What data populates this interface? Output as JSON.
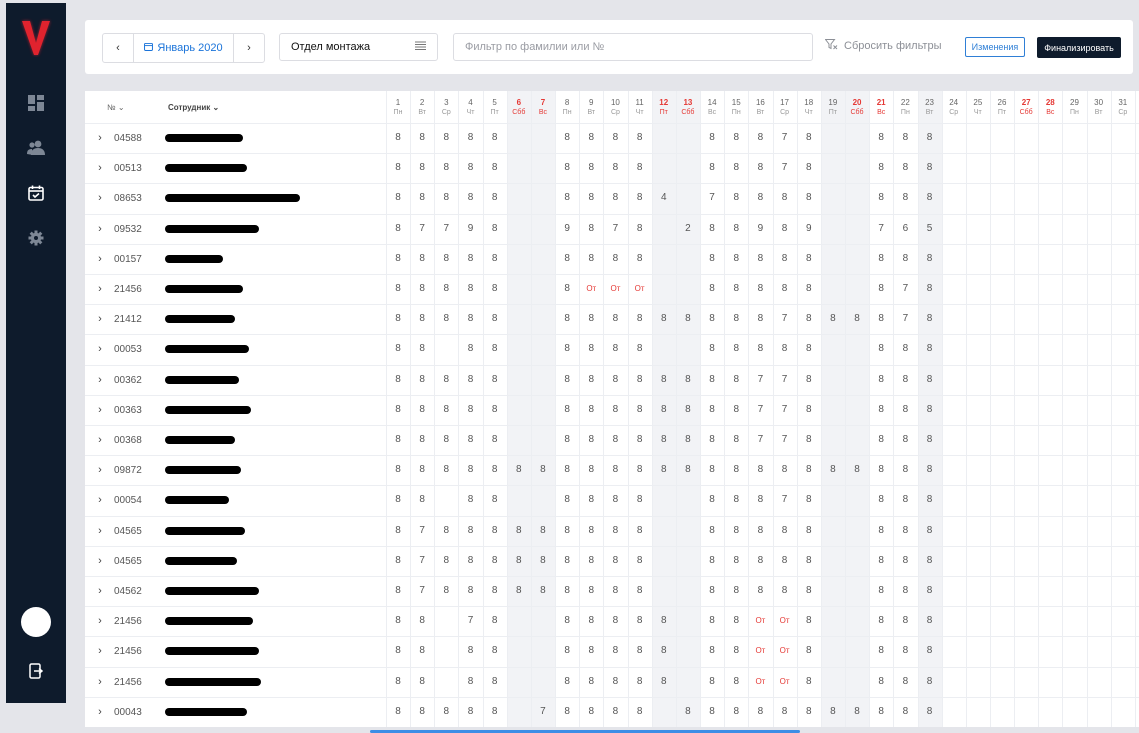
{
  "app": {
    "logo_letter": "V"
  },
  "sidebar": {
    "icons": [
      "dashboard-icon",
      "users-icon",
      "calendar-check-icon",
      "gear-icon"
    ],
    "logout_icon": "logout-icon"
  },
  "toolbar": {
    "month_label": "Январь 2020",
    "department": "Отдел монтажа",
    "filter_placeholder": "Фильтр по фамилии или №",
    "reset_label": "Сбросить фильтры",
    "changes_label": "Изменения",
    "finalize_label": "Финализировать"
  },
  "table": {
    "col_no": "№",
    "col_employee": "Сотрудник",
    "days": [
      {
        "d": "1",
        "w": "Пн",
        "h": false
      },
      {
        "d": "2",
        "w": "Вт",
        "h": false
      },
      {
        "d": "3",
        "w": "Ср",
        "h": false
      },
      {
        "d": "4",
        "w": "Чт",
        "h": false
      },
      {
        "d": "5",
        "w": "Пт",
        "h": false
      },
      {
        "d": "6",
        "w": "Сбб",
        "h": true
      },
      {
        "d": "7",
        "w": "Вс",
        "h": true
      },
      {
        "d": "8",
        "w": "Пн",
        "h": false
      },
      {
        "d": "9",
        "w": "Вт",
        "h": false
      },
      {
        "d": "10",
        "w": "Ср",
        "h": false
      },
      {
        "d": "11",
        "w": "Чт",
        "h": false
      },
      {
        "d": "12",
        "w": "Пт",
        "h": true
      },
      {
        "d": "13",
        "w": "Сбб",
        "h": true
      },
      {
        "d": "14",
        "w": "Вс",
        "h": false
      },
      {
        "d": "15",
        "w": "Пн",
        "h": false
      },
      {
        "d": "16",
        "w": "Вт",
        "h": false
      },
      {
        "d": "17",
        "w": "Ср",
        "h": false
      },
      {
        "d": "18",
        "w": "Чт",
        "h": false
      },
      {
        "d": "19",
        "w": "Пт",
        "h": false
      },
      {
        "d": "20",
        "w": "Сбб",
        "h": true
      },
      {
        "d": "21",
        "w": "Вс",
        "h": true
      },
      {
        "d": "22",
        "w": "Пн",
        "h": false
      },
      {
        "d": "23",
        "w": "Вт",
        "h": false
      },
      {
        "d": "24",
        "w": "Ср",
        "h": false
      },
      {
        "d": "25",
        "w": "Чт",
        "h": false
      },
      {
        "d": "26",
        "w": "Пт",
        "h": false
      },
      {
        "d": "27",
        "w": "Сбб",
        "h": true
      },
      {
        "d": "28",
        "w": "Вс",
        "h": true
      },
      {
        "d": "29",
        "w": "Пн",
        "h": false
      },
      {
        "d": "30",
        "w": "Вт",
        "h": false
      },
      {
        "d": "31",
        "w": "Ср",
        "h": false
      }
    ],
    "shaded_days": [
      6,
      7,
      12,
      13,
      19,
      20,
      23
    ],
    "rows": [
      {
        "id": "04588",
        "cells": [
          "8",
          "8",
          "8",
          "8",
          "8",
          "",
          "",
          "8",
          "8",
          "8",
          "8",
          "",
          "",
          "8",
          "8",
          "8",
          "7",
          "8",
          "",
          "",
          "8",
          "8",
          "8",
          "",
          "",
          "",
          "",
          "",
          "",
          "",
          ""
        ]
      },
      {
        "id": "00513",
        "cells": [
          "8",
          "8",
          "8",
          "8",
          "8",
          "",
          "",
          "8",
          "8",
          "8",
          "8",
          "",
          "",
          "8",
          "8",
          "8",
          "7",
          "8",
          "",
          "",
          "8",
          "8",
          "8",
          "",
          "",
          "",
          "",
          "",
          "",
          "",
          ""
        ]
      },
      {
        "id": "08653",
        "cells": [
          "8",
          "8",
          "8",
          "8",
          "8",
          "",
          "",
          "8",
          "8",
          "8",
          "8",
          "4",
          "",
          "7",
          "8",
          "8",
          "8",
          "8",
          "",
          "",
          "8",
          "8",
          "8",
          "",
          "",
          "",
          "",
          "",
          "",
          "",
          ""
        ]
      },
      {
        "id": "09532",
        "cells": [
          "8",
          "7",
          "7",
          "9",
          "8",
          "",
          "",
          "9",
          "8",
          "7",
          "8",
          "",
          "2",
          "8",
          "8",
          "9",
          "8",
          "9",
          "",
          "",
          "7",
          "6",
          "5",
          "",
          "",
          "",
          "",
          "",
          "",
          "",
          ""
        ]
      },
      {
        "id": "00157",
        "cells": [
          "8",
          "8",
          "8",
          "8",
          "8",
          "",
          "",
          "8",
          "8",
          "8",
          "8",
          "",
          "",
          "8",
          "8",
          "8",
          "8",
          "8",
          "",
          "",
          "8",
          "8",
          "8",
          "",
          "",
          "",
          "",
          "",
          "",
          "",
          ""
        ]
      },
      {
        "id": "21456",
        "cells": [
          "8",
          "8",
          "8",
          "8",
          "8",
          "",
          "",
          "8",
          "От",
          "От",
          "От",
          "",
          "",
          "8",
          "8",
          "8",
          "8",
          "8",
          "",
          "",
          "8",
          "7",
          "8",
          "",
          "",
          "",
          "",
          "",
          "",
          "",
          ""
        ]
      },
      {
        "id": "21412",
        "cells": [
          "8",
          "8",
          "8",
          "8",
          "8",
          "",
          "",
          "8",
          "8",
          "8",
          "8",
          "8",
          "8",
          "8",
          "8",
          "8",
          "7",
          "8",
          "8",
          "8",
          "8",
          "7",
          "8",
          "",
          "",
          "",
          "",
          "",
          "",
          "",
          ""
        ]
      },
      {
        "id": "00053",
        "cells": [
          "8",
          "8",
          "",
          "8",
          "8",
          "",
          "",
          "8",
          "8",
          "8",
          "8",
          "",
          "",
          "8",
          "8",
          "8",
          "8",
          "8",
          "",
          "",
          "8",
          "8",
          "8",
          "",
          "",
          "",
          "",
          "",
          "",
          "",
          ""
        ]
      },
      {
        "id": "00362",
        "cells": [
          "8",
          "8",
          "8",
          "8",
          "8",
          "",
          "",
          "8",
          "8",
          "8",
          "8",
          "8",
          "8",
          "8",
          "8",
          "7",
          "7",
          "8",
          "",
          "",
          "8",
          "8",
          "8",
          "",
          "",
          "",
          "",
          "",
          "",
          "",
          ""
        ]
      },
      {
        "id": "00363",
        "cells": [
          "8",
          "8",
          "8",
          "8",
          "8",
          "",
          "",
          "8",
          "8",
          "8",
          "8",
          "8",
          "8",
          "8",
          "8",
          "7",
          "7",
          "8",
          "",
          "",
          "8",
          "8",
          "8",
          "",
          "",
          "",
          "",
          "",
          "",
          "",
          ""
        ]
      },
      {
        "id": "00368",
        "cells": [
          "8",
          "8",
          "8",
          "8",
          "8",
          "",
          "",
          "8",
          "8",
          "8",
          "8",
          "8",
          "8",
          "8",
          "8",
          "7",
          "7",
          "8",
          "",
          "",
          "8",
          "8",
          "8",
          "",
          "",
          "",
          "",
          "",
          "",
          "",
          ""
        ]
      },
      {
        "id": "09872",
        "cells": [
          "8",
          "8",
          "8",
          "8",
          "8",
          "8",
          "8",
          "8",
          "8",
          "8",
          "8",
          "8",
          "8",
          "8",
          "8",
          "8",
          "8",
          "8",
          "8",
          "8",
          "8",
          "8",
          "8",
          "",
          "",
          "",
          "",
          "",
          "",
          "",
          ""
        ]
      },
      {
        "id": "00054",
        "cells": [
          "8",
          "8",
          "",
          "8",
          "8",
          "",
          "",
          "8",
          "8",
          "8",
          "8",
          "",
          "",
          "8",
          "8",
          "8",
          "7",
          "8",
          "",
          "",
          "8",
          "8",
          "8",
          "",
          "",
          "",
          "",
          "",
          "",
          "",
          ""
        ]
      },
      {
        "id": "04565",
        "cells": [
          "8",
          "7",
          "8",
          "8",
          "8",
          "8",
          "8",
          "8",
          "8",
          "8",
          "8",
          "",
          "",
          "8",
          "8",
          "8",
          "8",
          "8",
          "",
          "",
          "8",
          "8",
          "8",
          "",
          "",
          "",
          "",
          "",
          "",
          "",
          ""
        ]
      },
      {
        "id": "04565",
        "cells": [
          "8",
          "7",
          "8",
          "8",
          "8",
          "8",
          "8",
          "8",
          "8",
          "8",
          "8",
          "",
          "",
          "8",
          "8",
          "8",
          "8",
          "8",
          "",
          "",
          "8",
          "8",
          "8",
          "",
          "",
          "",
          "",
          "",
          "",
          "",
          ""
        ]
      },
      {
        "id": "04562",
        "cells": [
          "8",
          "7",
          "8",
          "8",
          "8",
          "8",
          "8",
          "8",
          "8",
          "8",
          "8",
          "",
          "",
          "8",
          "8",
          "8",
          "8",
          "8",
          "",
          "",
          "8",
          "8",
          "8",
          "",
          "",
          "",
          "",
          "",
          "",
          "",
          ""
        ]
      },
      {
        "id": "21456",
        "cells": [
          "8",
          "8",
          "",
          "7",
          "8",
          "",
          "",
          "8",
          "8",
          "8",
          "8",
          "8",
          "",
          "8",
          "8",
          "От",
          "От",
          "8",
          "",
          "",
          "8",
          "8",
          "8",
          "",
          "",
          "",
          "",
          "",
          "",
          "",
          ""
        ]
      },
      {
        "id": "21456",
        "cells": [
          "8",
          "8",
          "",
          "8",
          "8",
          "",
          "",
          "8",
          "8",
          "8",
          "8",
          "8",
          "",
          "8",
          "8",
          "От",
          "От",
          "8",
          "",
          "",
          "8",
          "8",
          "8",
          "",
          "",
          "",
          "",
          "",
          "",
          "",
          ""
        ]
      },
      {
        "id": "21456",
        "cells": [
          "8",
          "8",
          "",
          "8",
          "8",
          "",
          "",
          "8",
          "8",
          "8",
          "8",
          "8",
          "",
          "8",
          "8",
          "От",
          "От",
          "8",
          "",
          "",
          "8",
          "8",
          "8",
          "",
          "",
          "",
          "",
          "",
          "",
          "",
          ""
        ]
      },
      {
        "id": "00043",
        "cells": [
          "8",
          "8",
          "8",
          "8",
          "8",
          "",
          "7",
          "8",
          "8",
          "8",
          "8",
          "",
          "8",
          "8",
          "8",
          "8",
          "8",
          "8",
          "8",
          "8",
          "8",
          "8",
          "8",
          "",
          "",
          "",
          "",
          "",
          "",
          "",
          ""
        ]
      }
    ]
  },
  "colors": {
    "sidebar": "#0e1b2c",
    "accent": "#1a73d9",
    "holiday": "#e53935",
    "logo": "#e0232e"
  }
}
